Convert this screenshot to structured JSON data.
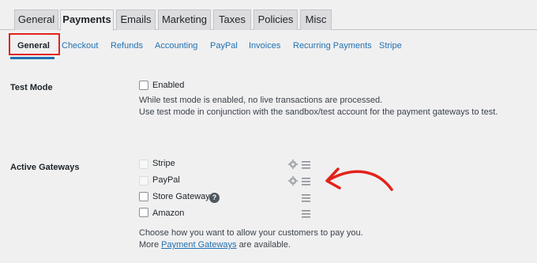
{
  "top_tabs": [
    {
      "label": "General"
    },
    {
      "label": "Payments"
    },
    {
      "label": "Emails"
    },
    {
      "label": "Marketing"
    },
    {
      "label": "Taxes"
    },
    {
      "label": "Policies"
    },
    {
      "label": "Misc"
    }
  ],
  "active_top_tab": "Payments",
  "sub_tabs": [
    {
      "label": "General"
    },
    {
      "label": "Checkout"
    },
    {
      "label": "Refunds"
    },
    {
      "label": "Accounting"
    },
    {
      "label": "PayPal"
    },
    {
      "label": "Invoices"
    },
    {
      "label": "Recurring Payments"
    },
    {
      "label": "Stripe"
    }
  ],
  "active_sub_tab": "General",
  "test_mode": {
    "label": "Test Mode",
    "checkbox_label": "Enabled",
    "desc_line1": "While test mode is enabled, no live transactions are processed.",
    "desc_line2": "Use test mode in conjunction with the sandbox/test account for the payment gateways to test."
  },
  "active_gateways": {
    "label": "Active Gateways",
    "items": [
      {
        "label": "Stripe",
        "icon": "gear-icon"
      },
      {
        "label": "PayPal",
        "icon": "gear-icon"
      },
      {
        "label": "Store Gateway",
        "icon": "help-icon",
        "help": "?"
      },
      {
        "label": "Amazon"
      }
    ],
    "desc_line1": "Choose how you want to allow your customers to pay you.",
    "desc_more_prefix": "More",
    "desc_link": "Payment Gateways",
    "desc_more_suffix": "are available."
  },
  "colors": {
    "accent": "#2271b1",
    "highlight": "#e2231a",
    "background": "#f0f0f1"
  }
}
